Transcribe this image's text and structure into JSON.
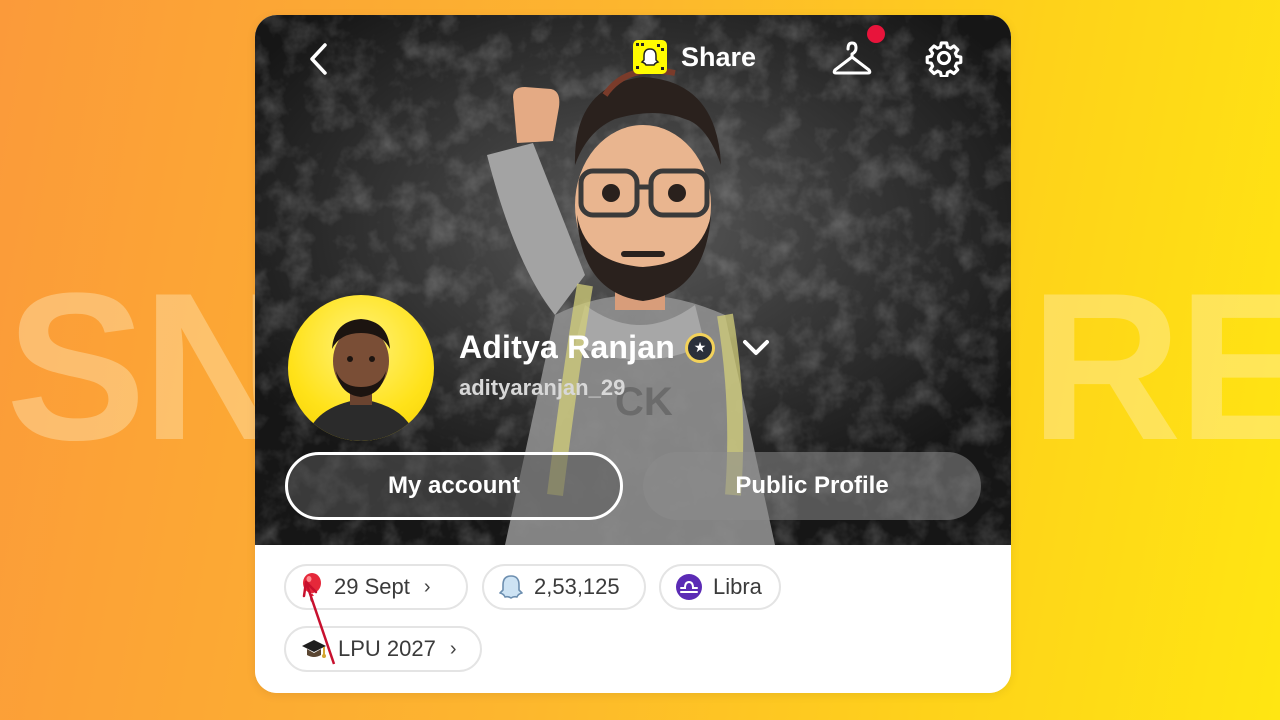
{
  "watermark": {
    "left": "SN",
    "right": "RE"
  },
  "header": {
    "share_label": "Share"
  },
  "profile": {
    "display_name": "Aditya Ranjan",
    "username": "adityaranjan_29"
  },
  "actions": {
    "my_account_label": "My account",
    "public_profile_label": "Public Profile"
  },
  "chips": {
    "birthday": "29 Sept",
    "snap_score": "2,53,125",
    "zodiac": "Libra",
    "school": "LPU 2027"
  },
  "icons": {
    "back": "chevron-left-icon",
    "snapcode": "snapcode-icon",
    "hanger": "hanger-icon",
    "settings": "gear-icon",
    "badge": "star-badge-icon",
    "expand": "chevron-down-icon",
    "birthday": "balloon-icon",
    "score": "ghost-icon",
    "zodiac": "libra-icon",
    "school": "graduation-cap-icon"
  },
  "colors": {
    "snap_yellow": "#fffc00",
    "notification_red": "#e8143b",
    "zodiac_purple": "#5b2bb5",
    "annotation_red": "#c8102e"
  }
}
